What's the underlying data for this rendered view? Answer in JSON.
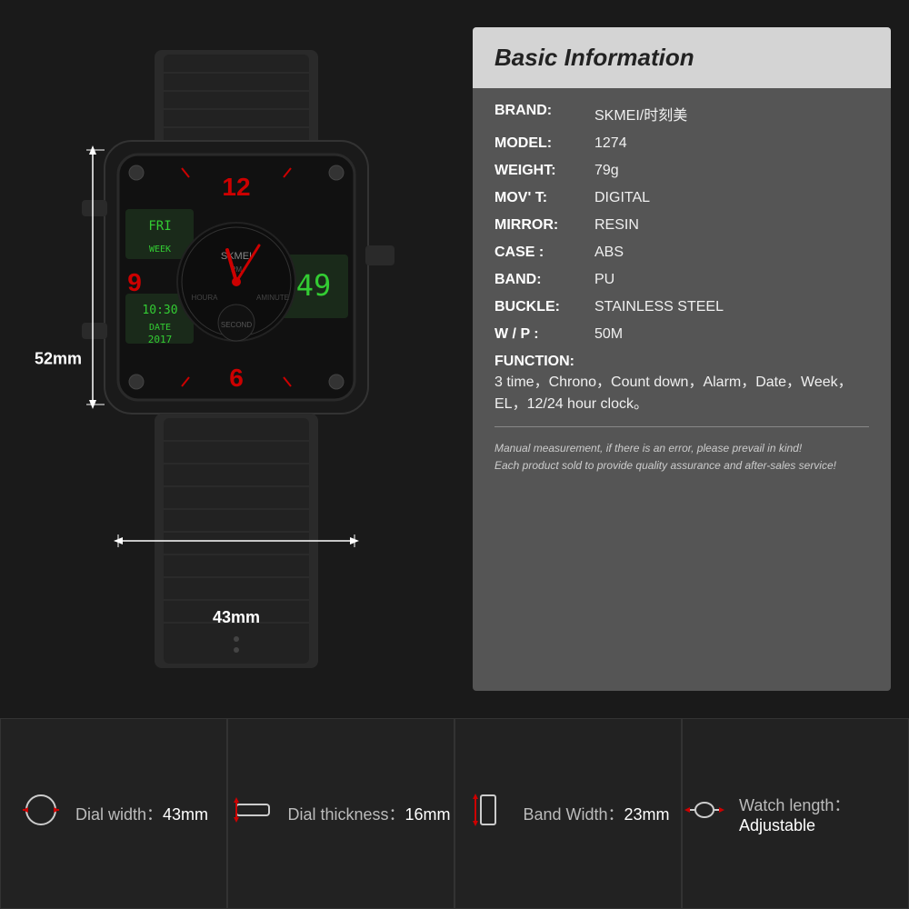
{
  "info": {
    "title": "Basic Information",
    "rows": [
      {
        "label": "BRAND:",
        "value": "SKMEI/时刻美"
      },
      {
        "label": "MODEL:",
        "value": "1274"
      },
      {
        "label": "WEIGHT:",
        "value": "79g"
      },
      {
        "label": "MOV' T:",
        "value": "DIGITAL"
      },
      {
        "label": "MIRROR:",
        "value": "RESIN"
      },
      {
        "label": "CASE :",
        "value": "ABS"
      },
      {
        "label": "BAND:",
        "value": "PU"
      },
      {
        "label": "BUCKLE:",
        "value": "STAINLESS STEEL"
      },
      {
        "label": "W / P :",
        "value": "50M"
      }
    ],
    "function_label": "FUNCTION:",
    "function_value": "3 time，Chrono，Count down，Alarm，Date，Week，EL，12/24 hour clock。",
    "footnote1": "Manual measurement, if there is an error, please prevail in kind!",
    "footnote2": "Each product sold to provide quality assurance and after-sales service!"
  },
  "dimensions": {
    "height_label": "52mm",
    "width_label": "43mm"
  },
  "specs": [
    {
      "icon": "⊙",
      "label": "Dial width：",
      "value": "43mm"
    },
    {
      "icon": "⊓",
      "label": "Dial thickness：",
      "value": "16mm"
    },
    {
      "icon": "▯",
      "label": "Band Width：",
      "value": "23mm"
    },
    {
      "icon": "⊙",
      "label": "Watch length：",
      "value": "Adjustable"
    }
  ]
}
